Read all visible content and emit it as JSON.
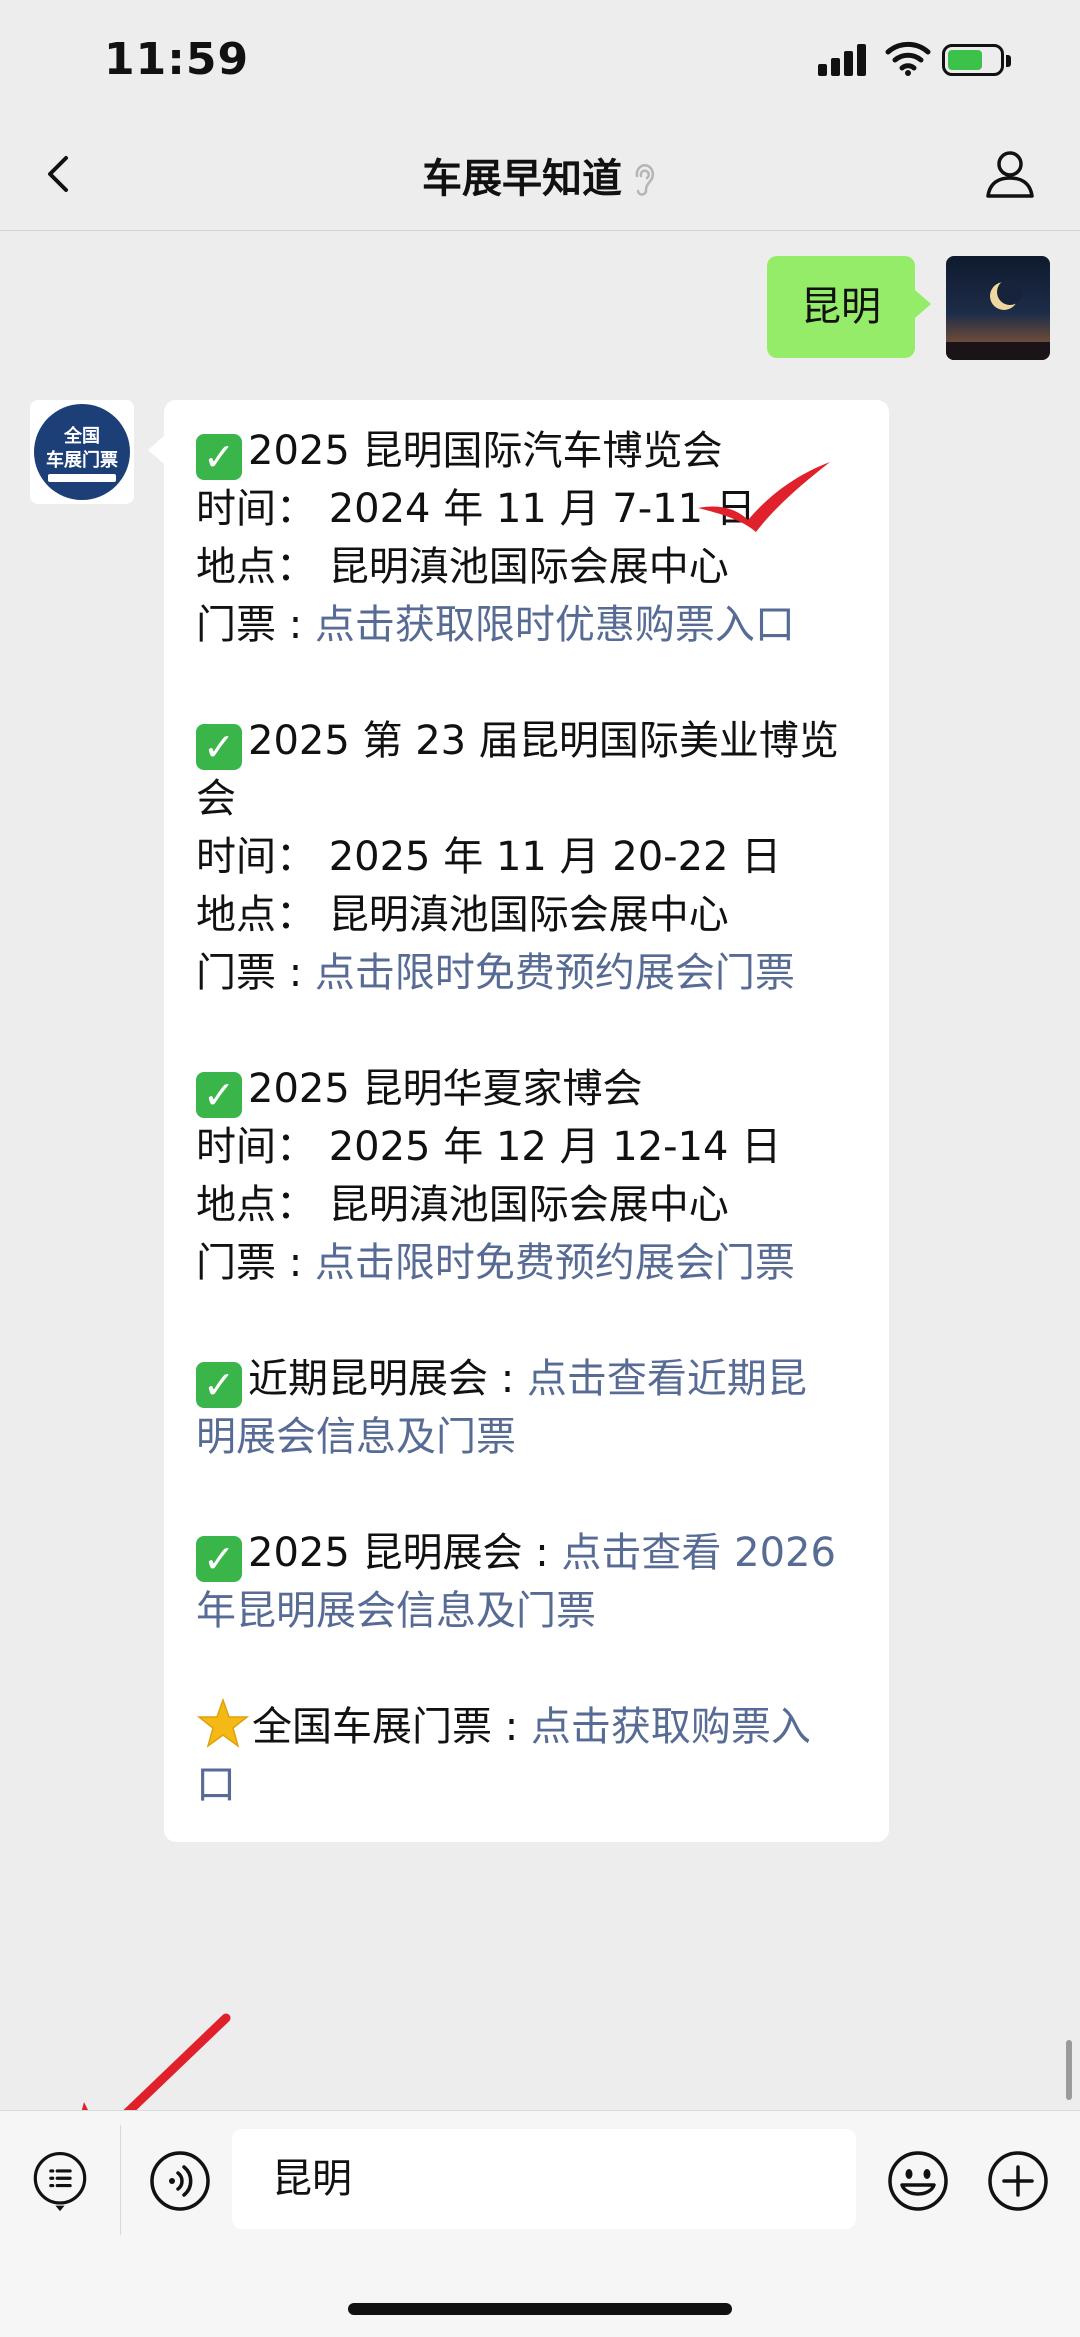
{
  "status_bar": {
    "time": "11:59"
  },
  "nav": {
    "title": "车展早知道"
  },
  "messages": {
    "self_text": "昆明",
    "bot_avatar": {
      "line1": "全国",
      "line2": "车展门票"
    },
    "lines": [
      {
        "check": true,
        "text": "2025 昆明国际汽车博览会"
      },
      {
        "text": "时间： 2024 年 11 月 7-11 日"
      },
      {
        "text": "地点： 昆明滇池国际会展中心"
      },
      {
        "label": "门票 : ",
        "link": "点击获取限时优惠购票入口"
      },
      {
        "check": true,
        "text": "2025 第 23 届昆明国际美业博览"
      },
      {
        "text": "会"
      },
      {
        "text": "时间： 2025 年 11 月 20-22 日"
      },
      {
        "text": "地点： 昆明滇池国际会展中心"
      },
      {
        "label": "门票 : ",
        "link": "点击限时免费预约展会门票"
      },
      {
        "check": true,
        "text": "2025 昆明华夏家博会"
      },
      {
        "text": "时间： 2025 年 12 月 12-14 日"
      },
      {
        "text": "地点： 昆明滇池国际会展中心"
      },
      {
        "label": "门票 : ",
        "link": "点击限时免费预约展会门票"
      },
      {
        "check": true,
        "label": "近期昆明展会 : ",
        "link": "点击查看近期昆"
      },
      {
        "link": "明展会信息及门票"
      },
      {
        "check": true,
        "label": "2025 昆明展会 : ",
        "link": "点击查看 2026"
      },
      {
        "link": "年昆明展会信息及门票"
      },
      {
        "star": true,
        "label": "全国车展门票 : ",
        "link": "点击获取购票入"
      },
      {
        "link": "口"
      }
    ]
  },
  "input": {
    "value": "昆明"
  },
  "colors": {
    "self_bubble": "#95ec69",
    "link": "#576b95",
    "check": "#3ab54a",
    "annotation": "#e0212b"
  }
}
